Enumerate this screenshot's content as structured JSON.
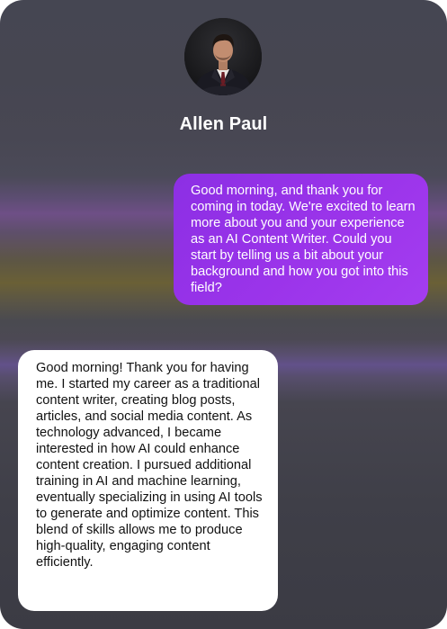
{
  "profile": {
    "name": "Allen Paul",
    "avatar_icon": "person-avatar"
  },
  "messages": [
    {
      "sender": "interviewer",
      "text": "Good morning, and thank you for coming in today. We're excited to learn more about you and your experience as an AI Content Writer. Could you start by telling us a bit about your background and how you got into this field?"
    },
    {
      "sender": "Allen Paul",
      "text": "Good morning! Thank you for having me. I started my career as a traditional content writer, creating blog posts, articles, and social media content. As technology advanced, I became interested in how AI could enhance content creation. I pursued additional training in AI and machine learning, eventually specializing in using AI tools to generate and optimize content. This blend of skills allows me to produce high-quality, engaging content efficiently."
    }
  ],
  "colors": {
    "interviewer_bubble": "#9b34ea",
    "candidate_bubble": "#ffffff",
    "background": "#454652"
  }
}
